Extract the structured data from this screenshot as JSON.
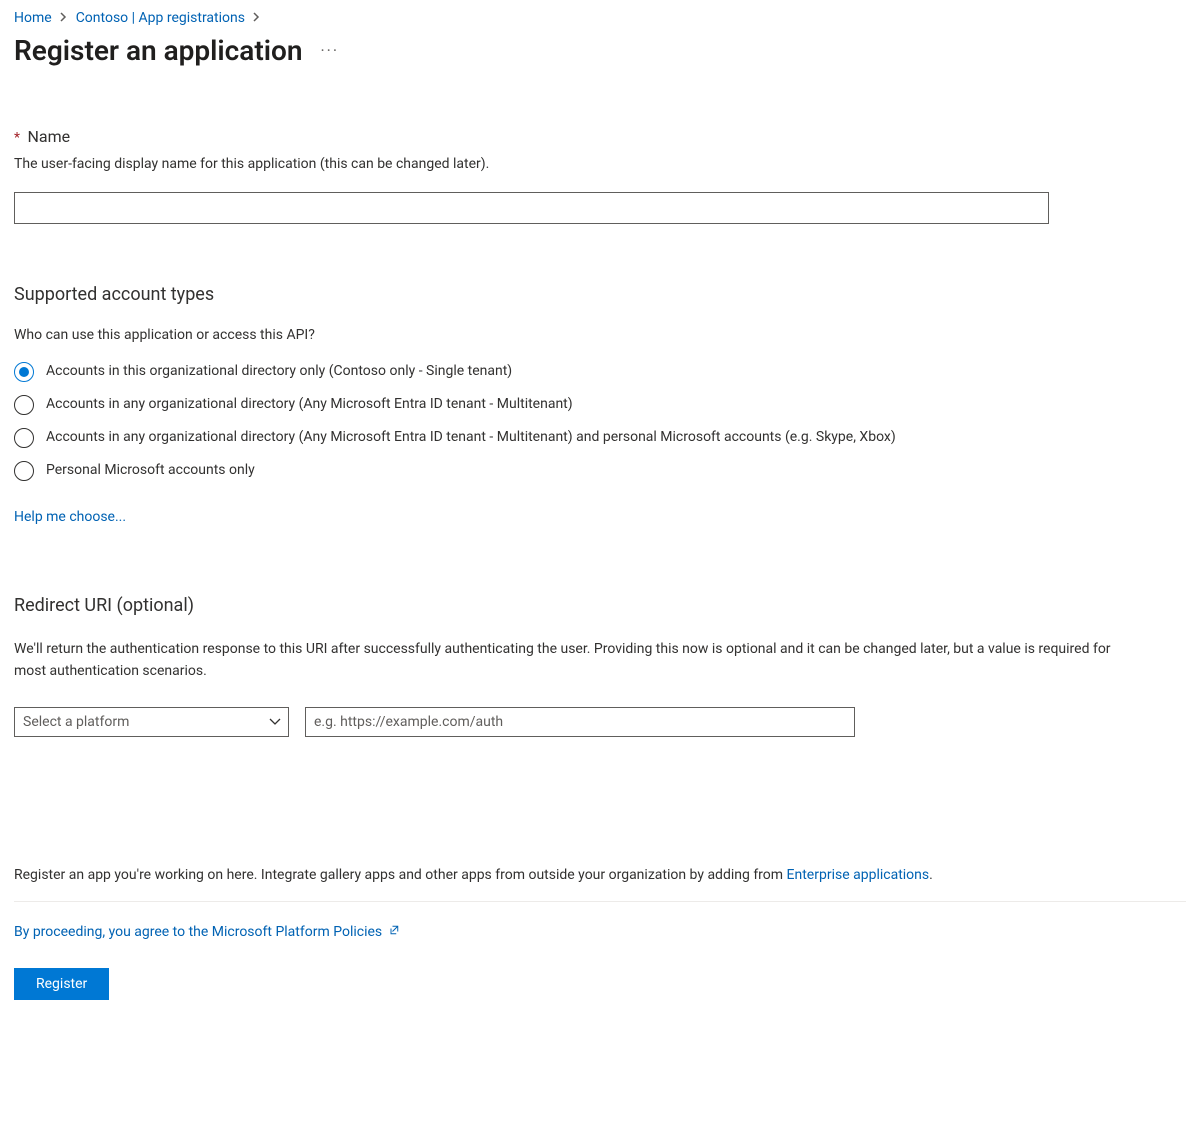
{
  "breadcrumb": {
    "home": "Home",
    "path": "Contoso | App registrations"
  },
  "title": "Register an application",
  "nameSection": {
    "label": "Name",
    "help": "The user-facing display name for this application (this can be changed later).",
    "value": ""
  },
  "accountTypes": {
    "heading": "Supported account types",
    "subtext": "Who can use this application or access this API?",
    "options": [
      "Accounts in this organizational directory only (Contoso only - Single tenant)",
      "Accounts in any organizational directory (Any Microsoft Entra ID tenant - Multitenant)",
      "Accounts in any organizational directory (Any Microsoft Entra ID tenant - Multitenant) and personal Microsoft accounts (e.g. Skype, Xbox)",
      "Personal Microsoft accounts only"
    ],
    "helpLink": "Help me choose..."
  },
  "redirect": {
    "heading": "Redirect URI (optional)",
    "desc": "We'll return the authentication response to this URI after successfully authenticating the user. Providing this now is optional and it can be changed later, but a value is required for most authentication scenarios.",
    "platformPlaceholder": "Select a platform",
    "uriPlaceholder": "e.g. https://example.com/auth"
  },
  "bottomNote": {
    "prefix": "Register an app you're working on here. Integrate gallery apps and other apps from outside your organization by adding from ",
    "link": "Enterprise applications",
    "suffix": "."
  },
  "policyText": "By proceeding, you agree to the Microsoft Platform Policies",
  "registerLabel": "Register"
}
